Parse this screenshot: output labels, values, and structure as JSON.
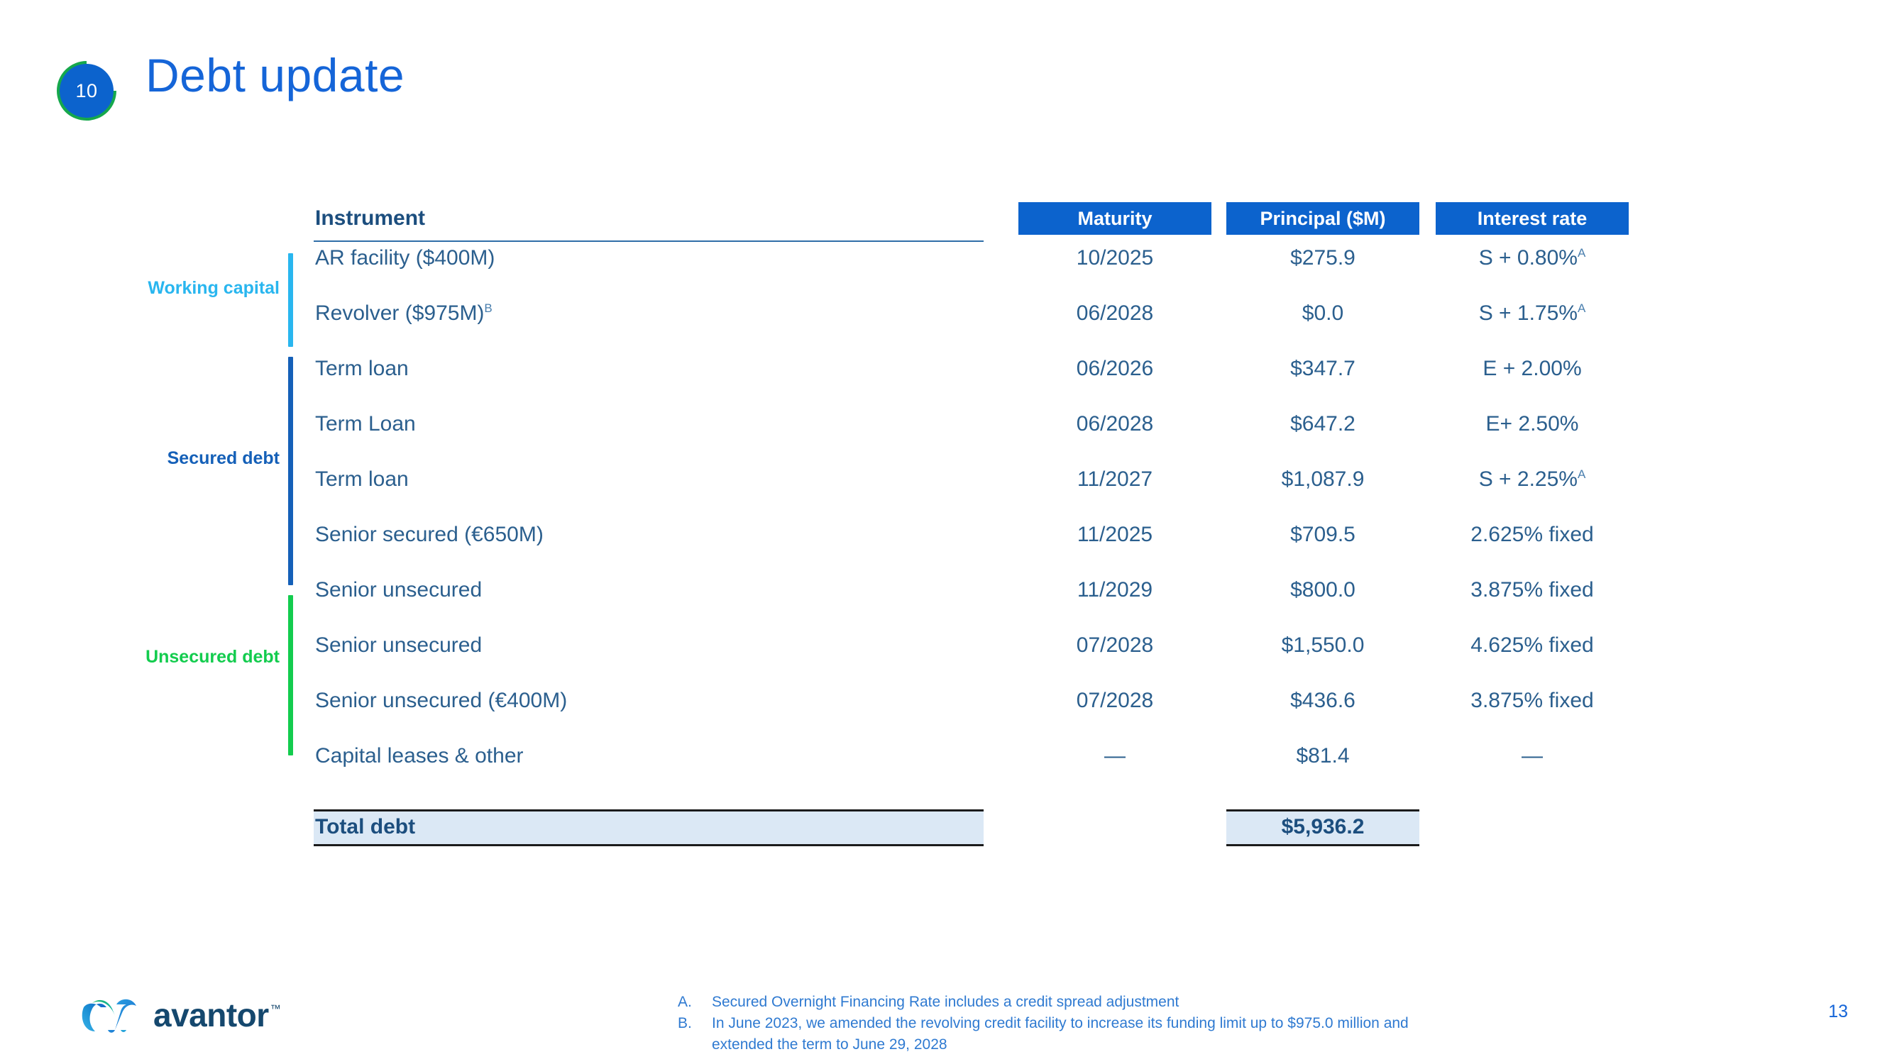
{
  "slide": {
    "badge_number": "10",
    "title": "Debt update",
    "page_number": "13"
  },
  "colors": {
    "header_blue": "#0c63cd",
    "title_blue": "#1565d8",
    "body_text": "#2b5f8e",
    "working_capital": "#29b6ef",
    "secured_debt": "#1560b8",
    "unsecured_debt": "#13cc4e",
    "total_fill": "#dbe8f5"
  },
  "table": {
    "instrument_header": "Instrument",
    "headers": {
      "maturity": "Maturity",
      "principal": "Principal ($M)",
      "interest_rate": "Interest rate"
    },
    "categories": {
      "working_capital": "Working capital",
      "secured_debt": "Secured debt",
      "unsecured_debt": "Unsecured debt"
    },
    "rows": [
      {
        "instrument": "AR facility ($400M)",
        "instrument_sup": "",
        "maturity": "10/2025",
        "principal": "$275.9",
        "rate": "S + 0.80%",
        "rate_sup": "A"
      },
      {
        "instrument": "Revolver ($975M)",
        "instrument_sup": "B",
        "maturity": "06/2028",
        "principal": "$0.0",
        "rate": "S + 1.75%",
        "rate_sup": "A"
      },
      {
        "instrument": "Term loan",
        "instrument_sup": "",
        "maturity": "06/2026",
        "principal": "$347.7",
        "rate": "E + 2.00%",
        "rate_sup": ""
      },
      {
        "instrument": "Term Loan",
        "instrument_sup": "",
        "maturity": "06/2028",
        "principal": "$647.2",
        "rate": "E+ 2.50%",
        "rate_sup": ""
      },
      {
        "instrument": "Term loan",
        "instrument_sup": "",
        "maturity": "11/2027",
        "principal": "$1,087.9",
        "rate": "S + 2.25%",
        "rate_sup": "A"
      },
      {
        "instrument": "Senior secured (€650M)",
        "instrument_sup": "",
        "maturity": "11/2025",
        "principal": "$709.5",
        "rate": "2.625% fixed",
        "rate_sup": ""
      },
      {
        "instrument": "Senior unsecured",
        "instrument_sup": "",
        "maturity": "11/2029",
        "principal": "$800.0",
        "rate": "3.875% fixed",
        "rate_sup": ""
      },
      {
        "instrument": "Senior unsecured",
        "instrument_sup": "",
        "maturity": "07/2028",
        "principal": "$1,550.0",
        "rate": "4.625% fixed",
        "rate_sup": ""
      },
      {
        "instrument": "Senior unsecured (€400M)",
        "instrument_sup": "",
        "maturity": "07/2028",
        "principal": "$436.6",
        "rate": "3.875% fixed",
        "rate_sup": ""
      },
      {
        "instrument": "Capital leases & other",
        "instrument_sup": "",
        "maturity": "—",
        "principal": "$81.4",
        "rate": "—",
        "rate_sup": ""
      }
    ],
    "total": {
      "label": "Total debt",
      "principal": "$5,936.2"
    }
  },
  "footnotes": [
    {
      "mark": "A.",
      "text": "Secured Overnight Financing Rate includes a credit spread adjustment"
    },
    {
      "mark": "B.",
      "text": "In June 2023, we amended the revolving credit facility to increase its funding limit up to $975.0 million and extended the term to June 29, 2028"
    }
  ],
  "footer": {
    "logo_text": "avantor",
    "logo_tm": "™"
  }
}
